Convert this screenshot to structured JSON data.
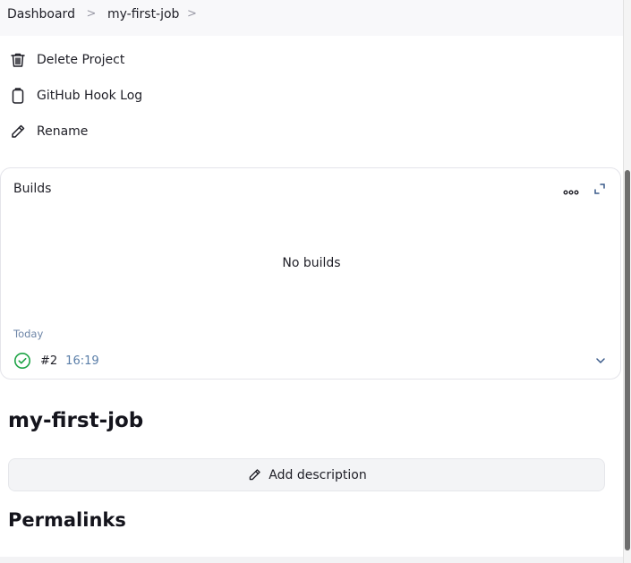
{
  "breadcrumb": {
    "items": [
      "Dashboard",
      "my-first-job"
    ],
    "separator": ">"
  },
  "actions": [
    {
      "label": "Delete Project",
      "icon": "trash-icon"
    },
    {
      "label": "GitHub Hook Log",
      "icon": "clipboard-icon"
    },
    {
      "label": "Rename",
      "icon": "pencil-icon"
    }
  ],
  "builds": {
    "title": "Builds",
    "more_icon": "ellipsis-icon",
    "expand_icon": "expand-icon",
    "empty_text": "No builds",
    "group_label": "Today",
    "entries": [
      {
        "number": "#2",
        "time": "16:19",
        "status": "success",
        "status_color": "#1ea446"
      }
    ]
  },
  "page": {
    "title": "my-first-job",
    "add_description_label": "Add description",
    "permalinks_heading": "Permalinks"
  },
  "colors": {
    "success": "#1ea446",
    "time_text": "#5a7ea8",
    "muted_label": "#6e86a8"
  }
}
